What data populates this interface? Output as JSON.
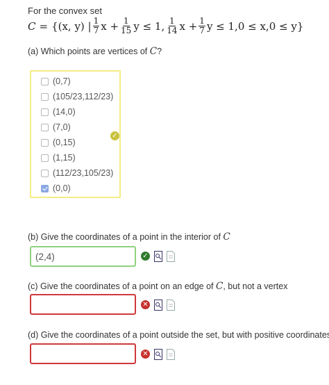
{
  "intro": "For the convex set",
  "set_def": {
    "lhs": "C",
    "eq": "=",
    "open": "{(x, y) |",
    "f1": {
      "num": "1",
      "den": "7"
    },
    "t1": "x +",
    "f2": {
      "num": "1",
      "den": "15"
    },
    "t2": "y ≤ 1,",
    "f3": {
      "num": "1",
      "den": "14"
    },
    "t3": "x +",
    "f4": {
      "num": "1",
      "den": "7"
    },
    "t4": "y ≤ 1,0 ≤ x,0 ≤ y}"
  },
  "part_a": {
    "question": "(a) Which points are vertices of",
    "var": "C",
    "qmark": "?",
    "choices": [
      {
        "label": "(0,7)",
        "checked": false
      },
      {
        "label": "(105/23,112/23)",
        "checked": false
      },
      {
        "label": "(14,0)",
        "checked": false
      },
      {
        "label": "(7,0)",
        "checked": false
      },
      {
        "label": "(0,15)",
        "checked": false
      },
      {
        "label": "(1,15)",
        "checked": false
      },
      {
        "label": "(112/23,105/23)",
        "checked": false
      },
      {
        "label": "(0,0)",
        "checked": true
      }
    ],
    "status": "partial"
  },
  "part_b": {
    "question": "(b) Give the coordinates of a point in the interior of",
    "var": "C",
    "value": "(2,4)",
    "status": "correct"
  },
  "part_c": {
    "question_pre": "(c) Give the coordinates of a point on an edge of",
    "var": "C",
    "question_post": ", but not a vertex",
    "value": "",
    "status": "wrong"
  },
  "part_d": {
    "question": "(d) Give the coordinates of a point outside the set, but with positive coordinates",
    "value": "",
    "status": "wrong"
  },
  "colors": {
    "partial_border": "#f4ec85",
    "correct_border": "#8ed17f",
    "wrong_border": "#d0383a",
    "check_accent": "#8aa8e3"
  },
  "icons": [
    "checkmark-icon",
    "x-mark-icon",
    "preview-icon",
    "help-doc-icon"
  ]
}
